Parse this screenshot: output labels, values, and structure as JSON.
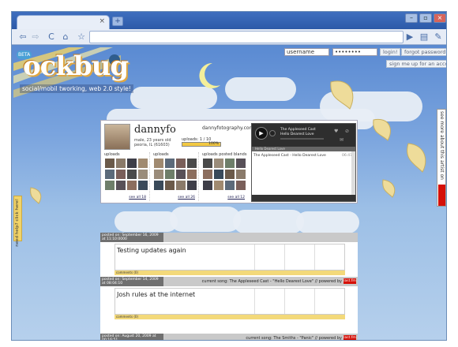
{
  "browser": {
    "tab_close": "×",
    "new_tab": "+",
    "buttons": {
      "back": "⇦",
      "forward": "⇨",
      "reload": "C",
      "home": "⌂",
      "star": "☆",
      "go": "▶",
      "page": "▤",
      "tools": "✎"
    },
    "window": {
      "min": "–",
      "max": "▫",
      "close": "×"
    }
  },
  "site": {
    "logo_text": "ockbug",
    "beta": "BETA",
    "tagline": "social/mobil  tworking, web 2.0 style!",
    "login": {
      "username_value": "username",
      "password_value": "••••••••",
      "login_label": "login!",
      "forgot_label": "forgot password?",
      "signup_label": "sign me up for an account!"
    }
  },
  "profile": {
    "name": "dannyfo",
    "info_line1": "male, 23 years old",
    "info_line2": "peoria, IL (61603)",
    "website": "dannyfotography.com",
    "upload_label": "uploads: 1 / 10",
    "upload_pct_label": "100%",
    "upload_fraction": 1.0,
    "galleries": [
      {
        "title": "uploads",
        "see_all": "see all 18"
      },
      {
        "title": "uploads",
        "see_all": "see all 26"
      },
      {
        "title": "uploads posted blands",
        "see_all": "see all 12"
      }
    ]
  },
  "player": {
    "artist": "The Appleseed Cast",
    "title": "Hello Dearest Love",
    "list_header": "Hello Dearest Love",
    "playlist_row": "The Appleseed Cast - Hello Dearest Love",
    "playlist_time": "06:47",
    "play_icon": "▶"
  },
  "side": {
    "right_text": "see more about this artist on",
    "left_text": "need help? click here!"
  },
  "posts": [
    {
      "meta_left": "posted on: September 16, 2009 at 11:10:0000",
      "song": "",
      "title": "Testing updates again",
      "footer": "comments (0)"
    },
    {
      "meta_left": "posted on: September 14, 2009 at 08:04:10",
      "song": "current song: The Appleseed Cast - \"Hello Dearest Love\" // powered by",
      "title": "Josh rules at the internet",
      "footer": "comments (0)"
    },
    {
      "meta_left": "posted on: August 20, 2009 at 00:16:51",
      "song": "current song: The Smiths - \"Panic\" // powered by",
      "title": "",
      "footer": ""
    }
  ],
  "lastfm_label": "last.fm"
}
